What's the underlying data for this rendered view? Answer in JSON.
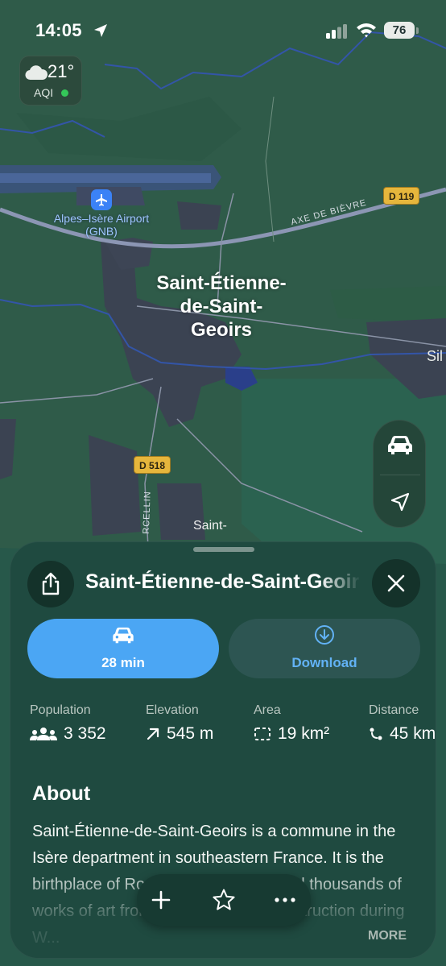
{
  "status_bar": {
    "time": "14:05",
    "battery": "76"
  },
  "weather": {
    "temperature": "21°",
    "aqi_label": "AQI",
    "icon": "cloud-icon",
    "aqi_color": "#34c759"
  },
  "map": {
    "airport_label": "Alpes–Isère Airport (GNB)",
    "town_label": "Saint-Étienne-de-Saint-Geoirs",
    "road_badges": [
      "D 119",
      "D 518"
    ],
    "road_names": [
      "AXE DE BIÈVRE",
      "RCELLIN"
    ],
    "edge_label": "Sil",
    "nearby_label": "Saint-"
  },
  "place_card": {
    "title": "Saint-Étienne-de-Saint-Geoirs",
    "drive_label": "28 min",
    "download_label": "Download",
    "accent_color": "#4ba6f4",
    "stats": [
      {
        "label": "Population",
        "value": "3 352",
        "icon": "people-icon"
      },
      {
        "label": "Elevation",
        "value": "545 m",
        "icon": "elevation-arrow-icon"
      },
      {
        "label": "Area",
        "value": "19 km²",
        "icon": "area-icon"
      },
      {
        "label": "Distance",
        "value": "45 km",
        "icon": "distance-icon"
      }
    ],
    "about_heading": "About",
    "about_text": "Saint-Étienne-de-Saint-Geoirs is a commune in the Isère department in southeastern France. It is the birthplace of Rose Valland, who saved thousands of works of art from Nazi looting and destruction during W...",
    "more_label": "MORE"
  }
}
